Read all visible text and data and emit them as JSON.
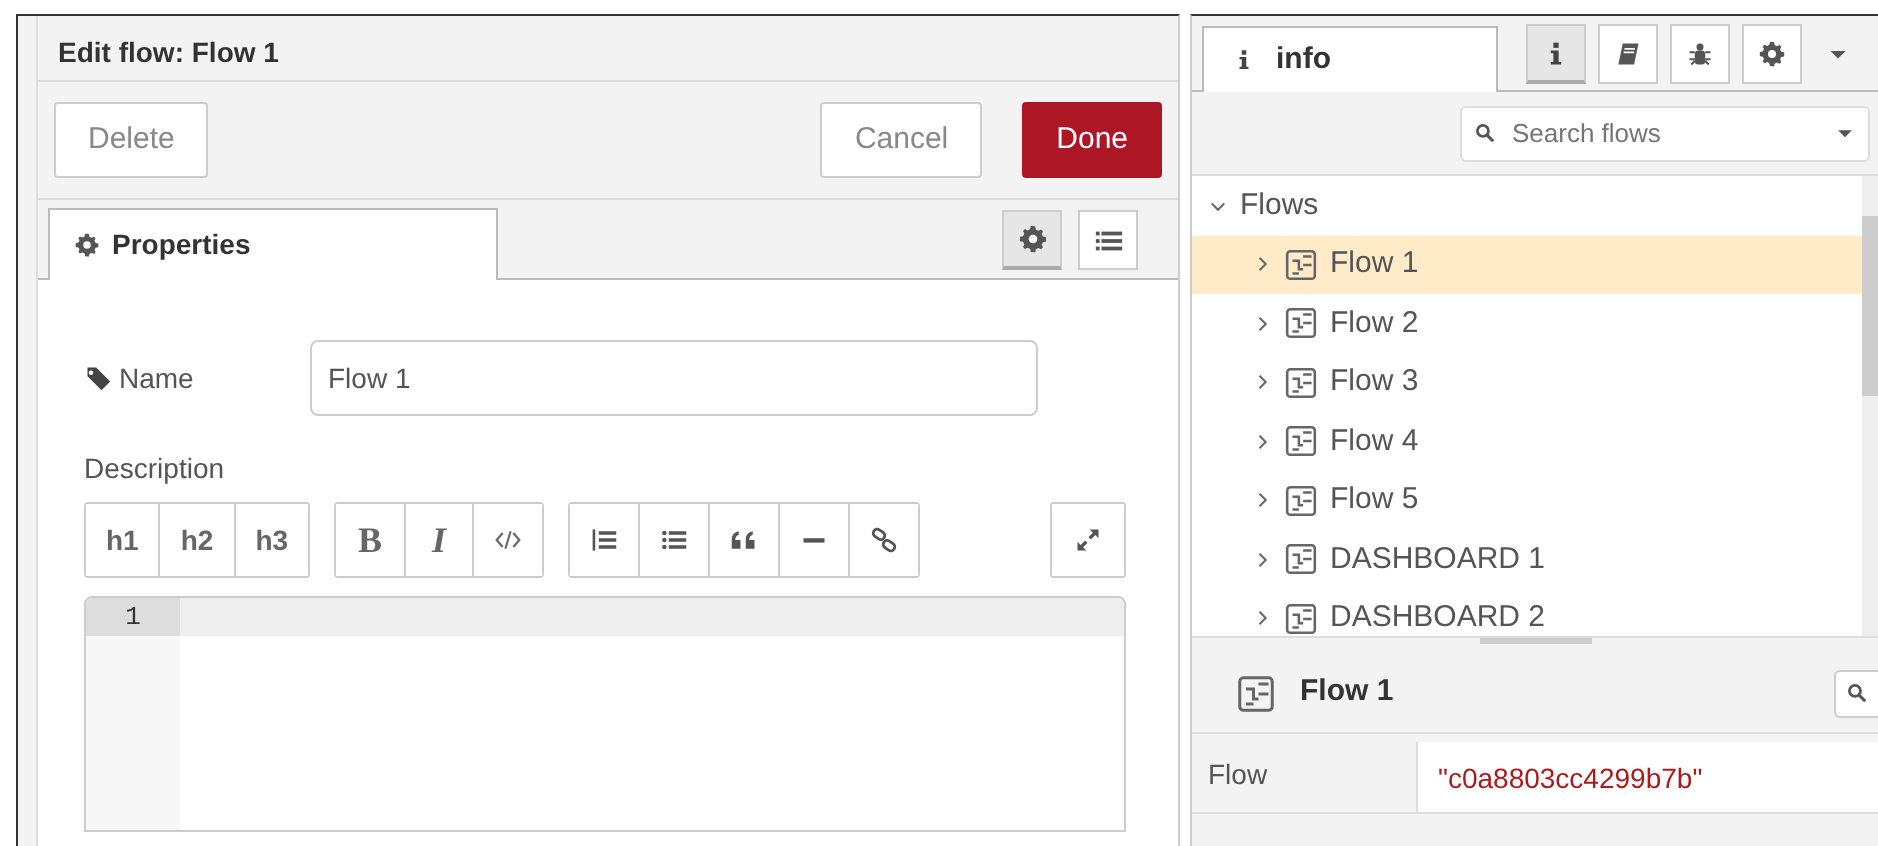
{
  "editor": {
    "title": "Edit flow: Flow 1",
    "buttons": [
      {
        "label": "Delete",
        "kind": "plain"
      },
      {
        "label": "Cancel",
        "kind": "plain"
      },
      {
        "label": "Done",
        "kind": "primary"
      }
    ],
    "tabs": [
      {
        "label": "Properties",
        "selected": true
      }
    ],
    "view_toggles": [
      {
        "kind": "gear",
        "selected": true
      },
      {
        "kind": "list",
        "selected": false
      }
    ],
    "name_label": "Name",
    "name_value": "Flow 1",
    "description_label": "Description",
    "toolbar": [
      [
        {
          "kind": "text",
          "label": "h1"
        },
        {
          "kind": "text",
          "label": "h2"
        },
        {
          "kind": "text",
          "label": "h3"
        }
      ],
      [
        {
          "kind": "serif-bold",
          "label": "B"
        },
        {
          "kind": "serif-italic",
          "label": "I"
        },
        {
          "kind": "code"
        }
      ],
      [
        {
          "kind": "ordered-list"
        },
        {
          "kind": "bullet-list"
        },
        {
          "kind": "quote"
        },
        {
          "kind": "rule"
        },
        {
          "kind": "link"
        }
      ],
      [
        {
          "kind": "expand"
        }
      ]
    ],
    "line_numbers": [
      "1"
    ]
  },
  "sidebar": {
    "tabs": [
      {
        "label": "info",
        "selected": true
      }
    ],
    "tool_buttons": [
      {
        "kind": "info",
        "selected": true
      },
      {
        "kind": "book",
        "selected": false
      },
      {
        "kind": "bug",
        "selected": false
      },
      {
        "kind": "gear",
        "selected": false
      }
    ],
    "search": {
      "placeholder": "Search flows"
    },
    "tree": [
      {
        "label": "Flows",
        "expanded": true,
        "children": [
          {
            "label": "Flow 1",
            "selected": true
          },
          {
            "label": "Flow 2",
            "selected": false
          },
          {
            "label": "Flow 3",
            "selected": false
          },
          {
            "label": "Flow 4",
            "selected": false
          },
          {
            "label": "Flow 5",
            "selected": false
          },
          {
            "label": "DASHBOARD 1",
            "selected": false
          },
          {
            "label": "DASHBOARD 2",
            "selected": false
          }
        ]
      }
    ],
    "info": {
      "title": "Flow 1",
      "rows": [
        {
          "key": "Flow",
          "value": "\"c0a8803cc4299b7b\""
        }
      ]
    }
  }
}
